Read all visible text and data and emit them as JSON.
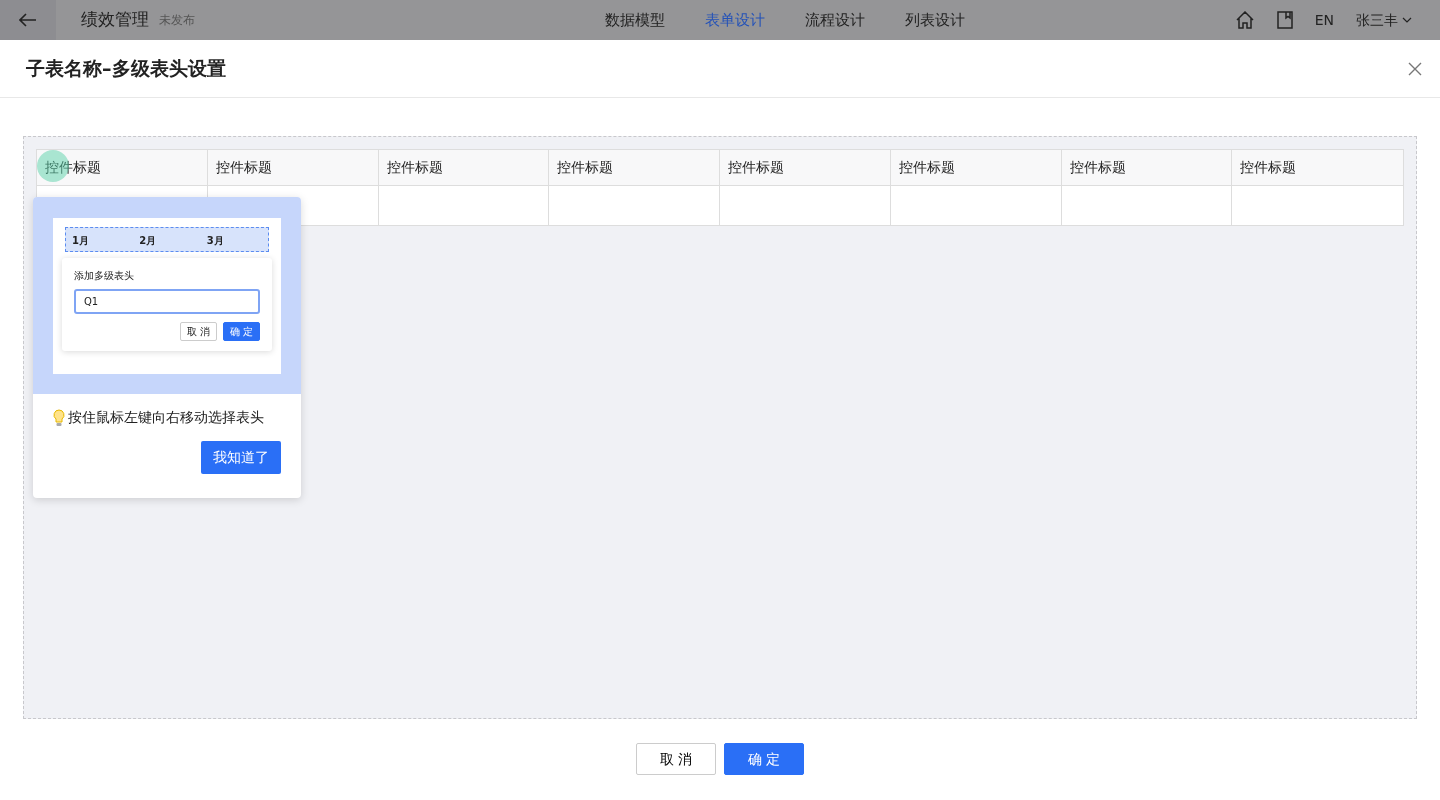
{
  "app_header": {
    "title": "绩效管理",
    "status": "未发布",
    "tabs": [
      {
        "label": "数据模型",
        "selected": false
      },
      {
        "label": "表单设计",
        "selected": true
      },
      {
        "label": "流程设计",
        "selected": false
      },
      {
        "label": "列表设计",
        "selected": false
      }
    ],
    "language": "EN",
    "user": "张三丰"
  },
  "dialog": {
    "title": "子表名称–多级表头设置",
    "table": {
      "columns": [
        "控件标题",
        "控件标题",
        "控件标题",
        "控件标题",
        "控件标题",
        "控件标题",
        "控件标题",
        "控件标题"
      ]
    },
    "guide": {
      "demo_headers": [
        "1月",
        "2月",
        "3月"
      ],
      "demo_popup": {
        "title": "添加多级表头",
        "value": "Q1",
        "buttons": [
          {
            "label": "取 消",
            "kind": "default"
          },
          {
            "label": "确 定",
            "kind": "primary"
          }
        ]
      },
      "tip": "按住鼠标左键向右移动选择表头",
      "button": "我知道了"
    },
    "buttons": [
      {
        "label": "取 消",
        "kind": "default"
      },
      {
        "label": "确 定",
        "kind": "primary"
      }
    ]
  }
}
